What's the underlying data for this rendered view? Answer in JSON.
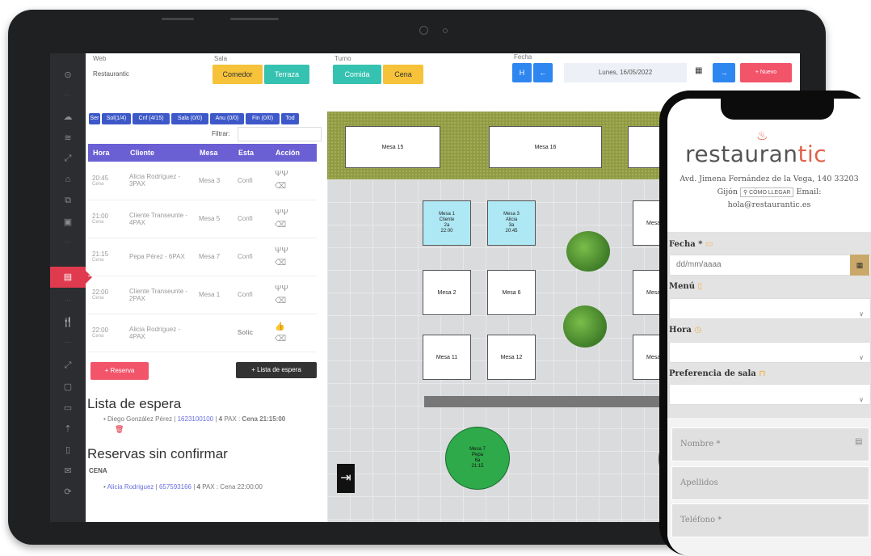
{
  "toolbar": {
    "web_label": "Web",
    "web_value": "Restaurantic",
    "sala_label": "Sala",
    "sala_options": [
      "Comedor",
      "Terraza"
    ],
    "turno_label": "Turno",
    "turno_options": [
      "Comida",
      "Cena"
    ],
    "fecha_label": "Fecha",
    "h_button": "H",
    "prev": "←",
    "next": "→",
    "date": "Lunes, 16/05/2022",
    "new_button": "+ Nuevo"
  },
  "filter_tabs": [
    "Ser",
    "Sol(1/4)",
    "Cnf (4/15)",
    "Sala (0/0)",
    "Anu (0/0)",
    "Fin (0/0)",
    "Tod"
  ],
  "filter_label": "Filtrar:",
  "table": {
    "headers": [
      "Hora",
      "Cliente",
      "Mesa",
      "Esta",
      "Acción"
    ],
    "rows": [
      {
        "hora": "20:45",
        "turno": "Cena",
        "cliente": "Alicia Rodríguez - 3PAX",
        "mesa": "Mesa 3",
        "estado": "Confi"
      },
      {
        "hora": "21:00",
        "turno": "Cena",
        "cliente": "Cliente Transeunte - 4PAX",
        "mesa": "Mesa 5",
        "estado": "Confi"
      },
      {
        "hora": "21:15",
        "turno": "Cena",
        "cliente": "Pepa Pérez - 6PAX",
        "mesa": "Mesa 7",
        "estado": "Confi"
      },
      {
        "hora": "22:00",
        "turno": "Cena",
        "cliente": "Cliente Transeunte - 2PAX",
        "mesa": "Mesa 1",
        "estado": "Confi"
      },
      {
        "hora": "22:00",
        "turno": "Cena",
        "cliente": "Alicia Rodríguez - 4PAX",
        "mesa": "",
        "estado": "Solic"
      }
    ]
  },
  "actions": {
    "reserva": "+ Reserva",
    "lista": "+ Lista de espera"
  },
  "waitlist": {
    "title": "Lista de espera",
    "entry_name": "Diego González Pérez",
    "entry_phone": "1623100100",
    "entry_pax": "4",
    "entry_rest": "PAX : ",
    "entry_time": "Cena 21:15:00"
  },
  "unconfirmed": {
    "title": "Reservas sin confirmar",
    "section": "CENA",
    "entry_name": "Alicia Rodriguez",
    "entry_phone": "657593166",
    "entry_pax": "4",
    "entry_rest": "PAX : Cena 22:00:00"
  },
  "floor": {
    "tables": [
      "Mesa 15",
      "Mesa 16",
      "Mesa 2",
      "Mesa 6",
      "Mesa 11",
      "Mesa 12"
    ],
    "partial_tables": [
      "Mesa 4",
      "Mesa 8",
      "Mesa 13"
    ],
    "mesa1": [
      "Mesa 1",
      "Cliente",
      "2a",
      "22:00"
    ],
    "mesa3": [
      "Mesa 3",
      "Alicia",
      "3a",
      "20:45"
    ],
    "mesa7": [
      "Mesa 7",
      "Pepa",
      "6a",
      "21:15"
    ]
  },
  "phone": {
    "logo_main": "restauran",
    "logo_accent": "tic",
    "address": "Avd. Jimena Fernández de la Vega, 140 33203",
    "city": "Gijón",
    "directions": "CÓMO LLEGAR",
    "email_label": "Email:",
    "email": "hola@restaurantic.es",
    "fecha_label": "Fecha *",
    "fecha_placeholder": "dd/mm/aaaa",
    "menu_label": "Menú",
    "hora_label": "Hora",
    "sala_label": "Preferencia de sala",
    "nombre_placeholder": "Nombre *",
    "apellidos_placeholder": "Apellidos",
    "telefono_placeholder": "Teléfono *"
  },
  "colors": {
    "accent": "#e03a4e",
    "purple": "#6b5fd4",
    "yellow": "#f5c23a",
    "teal": "#36c2b0",
    "blue": "#2e86f0",
    "green": "#2eaa4a"
  }
}
